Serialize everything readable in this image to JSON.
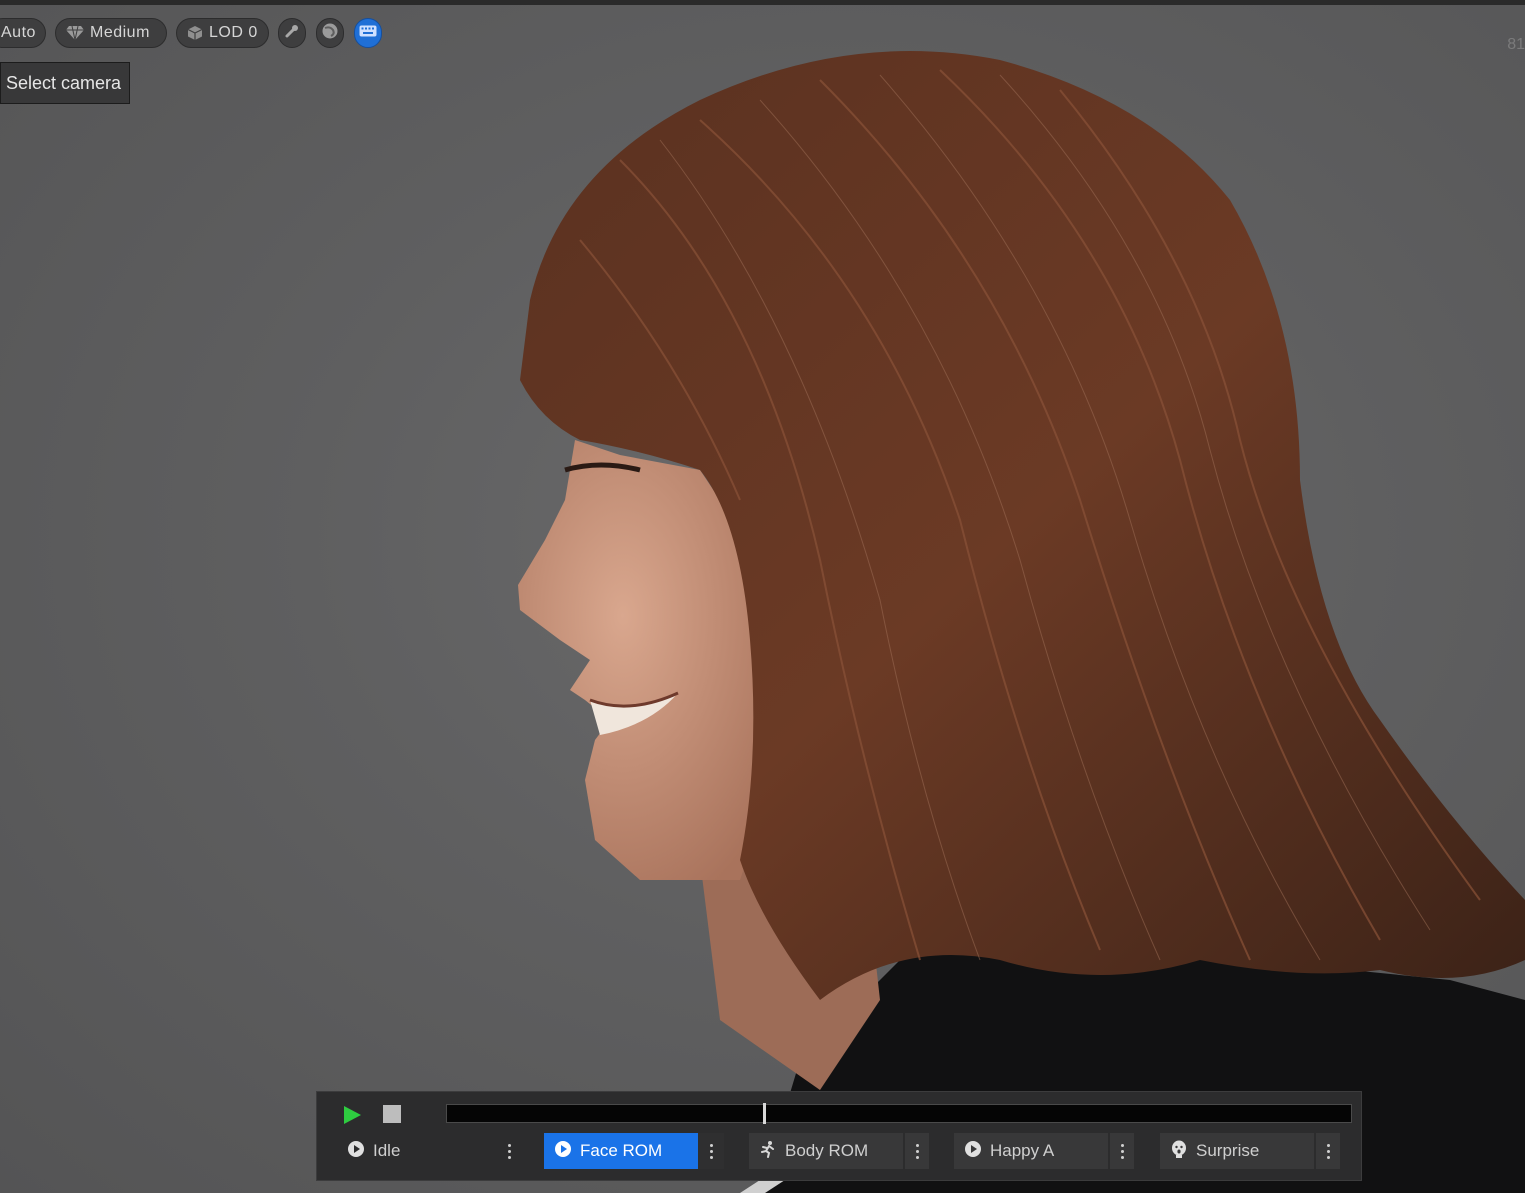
{
  "toolbar": {
    "auto_label": "Auto",
    "quality_label": "Medium",
    "quality_icon": "gem-icon",
    "lod_label": "LOD 0",
    "lod_icon": "cube-icon",
    "icon_buttons": [
      "wrench-icon",
      "sphere-icon",
      "keyboard-icon"
    ],
    "active_color": "#1a73e8"
  },
  "camera": {
    "select_label": "Select camera"
  },
  "overlay": {
    "fps_text": "81"
  },
  "playback": {
    "progress": 0.35,
    "play_color": "#2ecc40",
    "animations": [
      {
        "label": "Idle",
        "icon": "play-circle-icon",
        "selected": false
      },
      {
        "label": "Face ROM",
        "icon": "play-circle-icon",
        "selected": true
      },
      {
        "label": "Body ROM",
        "icon": "running-figure-icon",
        "selected": false
      },
      {
        "label": "Happy A",
        "icon": "play-circle-icon",
        "selected": false
      },
      {
        "label": "Surprise",
        "icon": "face-icon",
        "selected": false
      }
    ]
  }
}
